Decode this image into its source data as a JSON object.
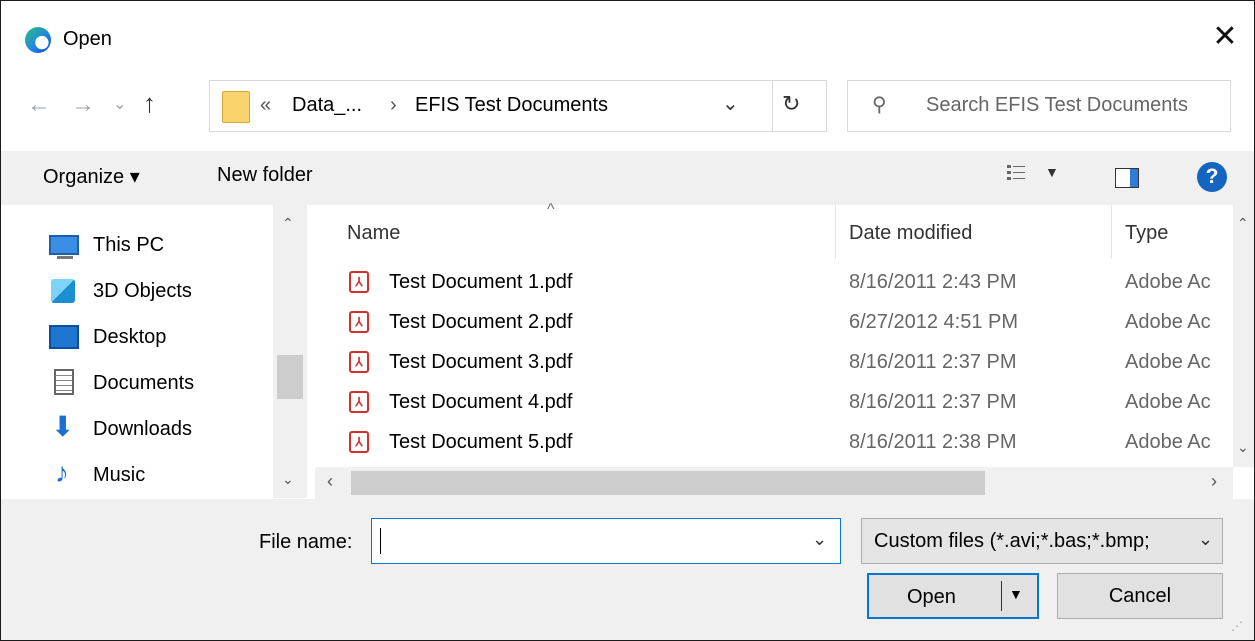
{
  "window": {
    "title": "Open"
  },
  "address": {
    "overflow": "«",
    "crumbs": [
      "Data_...",
      "EFIS Test Documents"
    ],
    "separator": "›"
  },
  "search": {
    "placeholder": "Search EFIS Test Documents"
  },
  "toolbar": {
    "organize": "Organize ▾",
    "new_folder": "New folder"
  },
  "nav": {
    "items": [
      {
        "label": "This PC",
        "icon": "pc-icon"
      },
      {
        "label": "3D Objects",
        "icon": "cube-icon"
      },
      {
        "label": "Desktop",
        "icon": "desktop-icon"
      },
      {
        "label": "Documents",
        "icon": "documents-icon"
      },
      {
        "label": "Downloads",
        "icon": "downloads-icon"
      },
      {
        "label": "Music",
        "icon": "music-icon"
      }
    ]
  },
  "columns": {
    "name": "Name",
    "date": "Date modified",
    "type": "Type"
  },
  "files": [
    {
      "name": "Test Document 1.pdf",
      "date": "8/16/2011 2:43 PM",
      "type": "Adobe Ac"
    },
    {
      "name": "Test Document 2.pdf",
      "date": "6/27/2012 4:51 PM",
      "type": "Adobe Ac"
    },
    {
      "name": "Test Document 3.pdf",
      "date": "8/16/2011 2:37 PM",
      "type": "Adobe Ac"
    },
    {
      "name": "Test Document 4.pdf",
      "date": "8/16/2011 2:37 PM",
      "type": "Adobe Ac"
    },
    {
      "name": "Test Document 5.pdf",
      "date": "8/16/2011 2:38 PM",
      "type": "Adobe Ac"
    }
  ],
  "filename": {
    "label": "File name:",
    "value": ""
  },
  "filetype": {
    "selected": "Custom files (*.avi;*.bas;*.bmp;"
  },
  "buttons": {
    "open": "Open",
    "cancel": "Cancel"
  },
  "colors": {
    "accent": "#0078d4",
    "help": "#1565c0",
    "pdf": "#d32f2f"
  }
}
